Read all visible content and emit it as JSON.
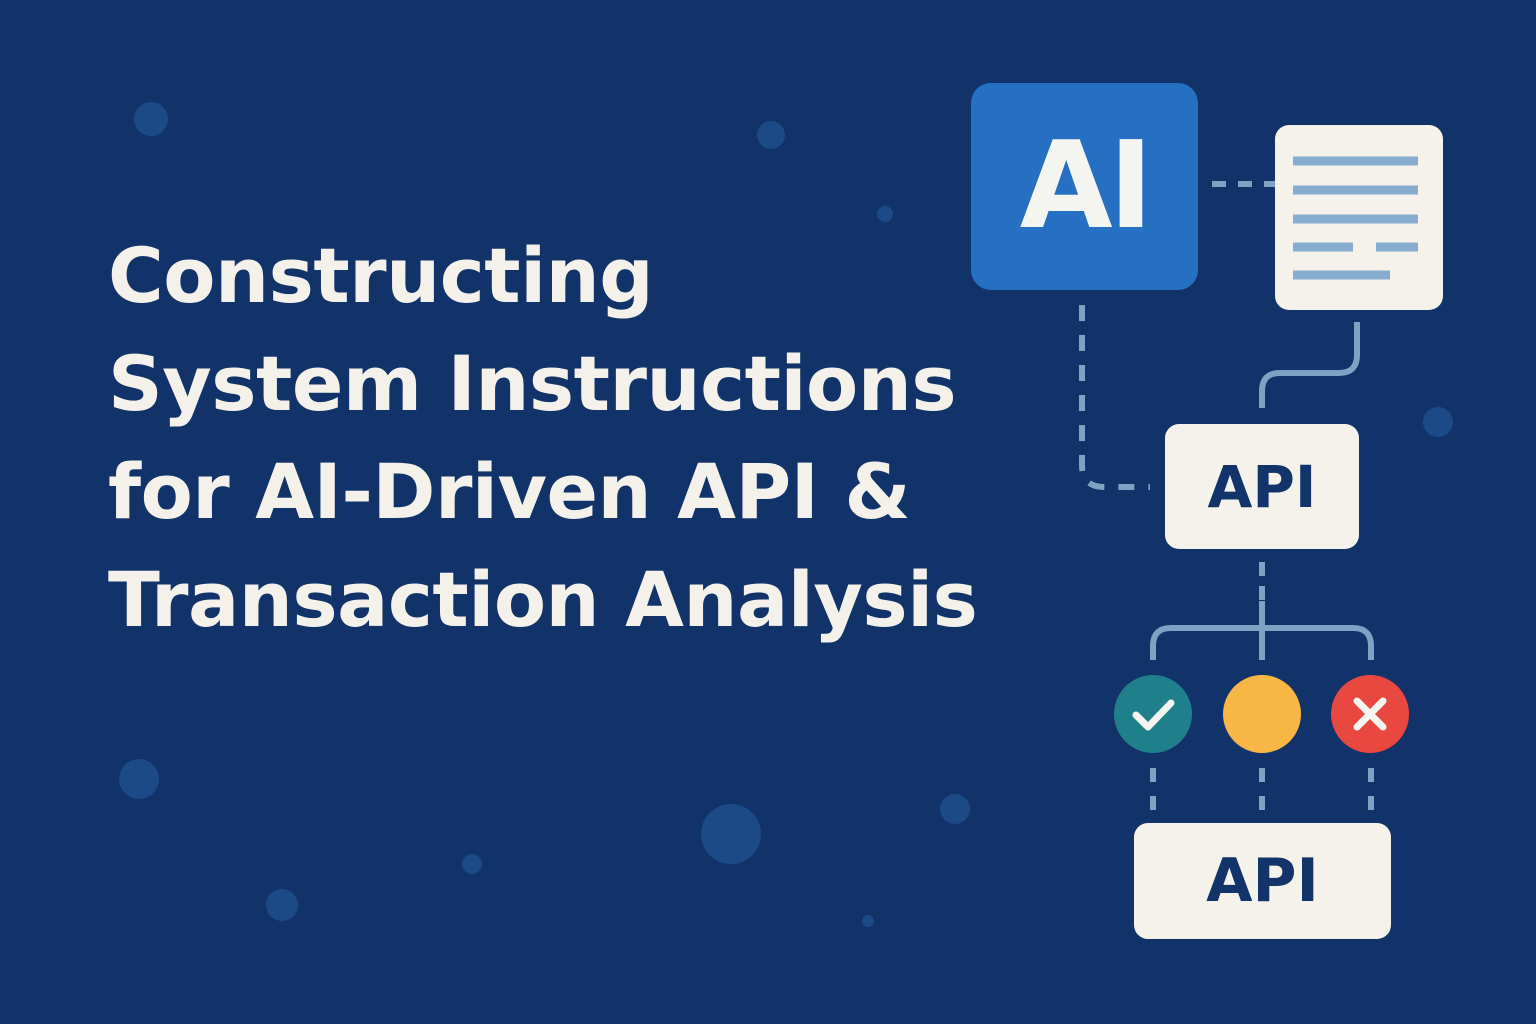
{
  "title": {
    "lines": [
      "Constructing",
      "System Instructions",
      "for AI-Driven API &",
      "Transaction Analysis"
    ]
  },
  "diagram": {
    "ai_node": {
      "label": "AI",
      "color": "#2670c4"
    },
    "document_node": {
      "icon": "document-lines-icon"
    },
    "api_node_top": {
      "label": "API"
    },
    "status_nodes": [
      {
        "name": "success",
        "icon": "check-icon",
        "color": "#1f7f8a"
      },
      {
        "name": "pending",
        "icon": "none",
        "color": "#f8b745"
      },
      {
        "name": "error",
        "icon": "close-icon",
        "color": "#e8483f"
      }
    ],
    "api_node_bottom": {
      "label": "API"
    }
  },
  "colors": {
    "background": "#11336a",
    "text": "#f3f1ea",
    "connector": "#7fa2c4",
    "dot": "#1c4a87"
  }
}
